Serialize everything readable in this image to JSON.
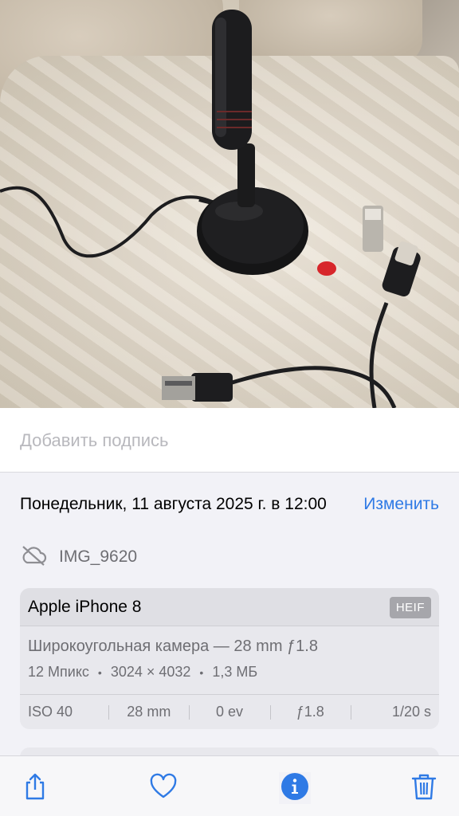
{
  "photo": {
    "description_icon": "photo"
  },
  "caption": {
    "placeholder": "Добавить подпись"
  },
  "info": {
    "date": "Понедельник, 11 августа 2025 г. в 12:00",
    "edit_label": "Изменить",
    "filename": "IMG_9620",
    "cloud_icon": "cloud-slash-icon"
  },
  "camera": {
    "device": "Apple iPhone 8",
    "format": "HEIF",
    "lens": "Широкоугольная камера — 28 mm ƒ1.8",
    "megapixels": "12 Мпикс",
    "resolution": "3024 × 4032",
    "size": "1,3 МБ",
    "exif": {
      "iso": "ISO 40",
      "focal": "28 mm",
      "ev": "0 ev",
      "aperture": "ƒ1.8",
      "shutter": "1/20 s"
    }
  },
  "toolbar": {
    "share_icon": "share-icon",
    "like_icon": "heart-icon",
    "info_icon": "info-icon",
    "delete_icon": "trash-icon"
  },
  "colors": {
    "accent": "#2f7ae5",
    "background": "#f2f2f7",
    "secondary_text": "#6e6e73"
  }
}
